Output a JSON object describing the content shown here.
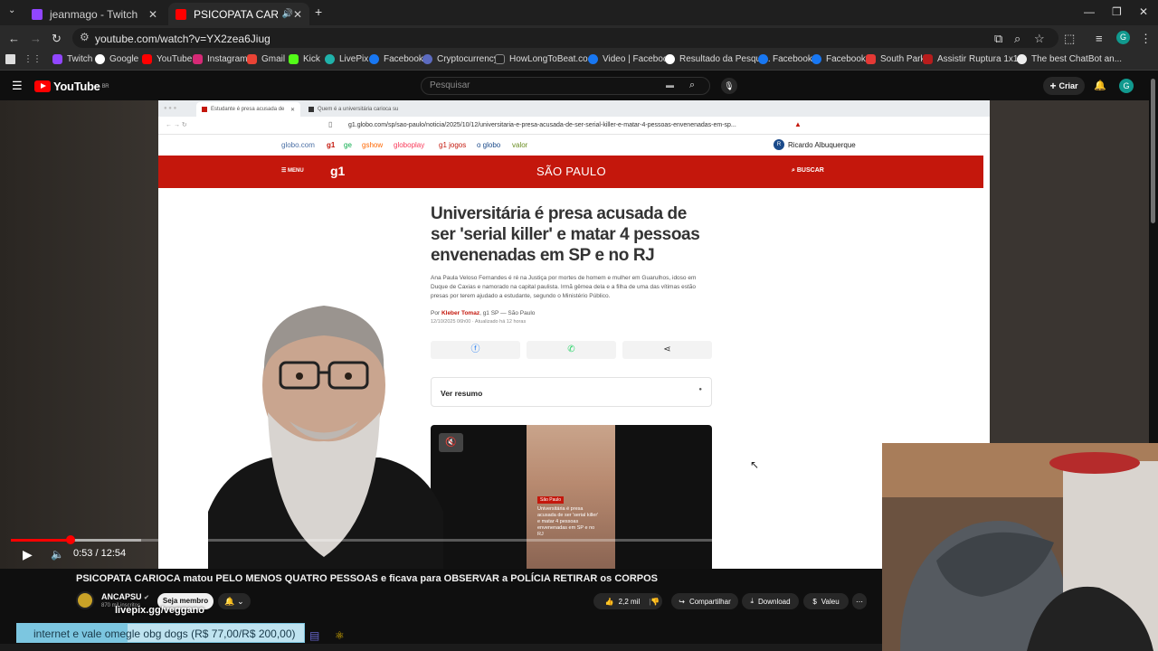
{
  "browser": {
    "tabs": [
      {
        "title": "jeanmago - Twitch",
        "color": "#9146ff"
      },
      {
        "title": "PSICOPATA CARIOCA matou",
        "color": "#ff0000"
      }
    ],
    "url": "youtube.com/watch?v=YX2zea6Jiug",
    "bookmarks": [
      "Twitch",
      "Google",
      "YouTube",
      "Instagram",
      "Gmail",
      "Kick",
      "LivePix",
      "Facebook",
      "Cryptocurrency",
      "HowLongToBeat.co...",
      "Video | Facebook",
      "Resultado da Pesqui...",
      "Facebook",
      "Facebook",
      "South Park",
      "Assistir Ruptura 1x1...",
      "The best ChatBot an..."
    ]
  },
  "youtube": {
    "logo": "YouTube",
    "logo_region": "BR",
    "search_placeholder": "Pesquisar",
    "create_label": "Criar",
    "avatar_letter": "G"
  },
  "inner_page": {
    "tabs": [
      "Estudante é presa acusada de",
      "Quem é a universitária carioca su"
    ],
    "url": "g1.globo.com/sp/sao-paulo/noticia/2025/10/12/universitaria-e-presa-acusada-de-ser-serial-killer-e-matar-4-pessoas-envenenadas-em-sp...",
    "globo_links": [
      "globo.com",
      "g1",
      "ge",
      "gshow",
      "globoplay",
      "g1 jogos",
      "o globo",
      "valor"
    ],
    "user": "Ricardo Albuquerque",
    "menu_label": "MENU",
    "site_logo": "g1",
    "section": "SÃO PAULO",
    "search_label": "BUSCAR",
    "headline": "Universitária é presa acusada de ser 'serial killer' e matar 4 pessoas envenenadas em SP e no RJ",
    "subheadline": "Ana Paula Veloso Fernandes é ré na Justiça por mortes de homem e mulher em Guarulhos, idoso em Duque de Caxias e namorado na capital paulista. Irmã gêmea dela e a filha de uma das vítimas estão presas por terem ajudado a estudante, segundo o Ministério Público.",
    "byline_prefix": "Por",
    "author": "Kleber Tomaz",
    "byline_suffix": ", g1 SP — São Paulo",
    "dateline": "12/10/2025 06h00 · Atualizado há 12 horas",
    "summary_label": "Ver resumo",
    "video_tag": "São Paulo",
    "video_caption": "Universitária é presa acusada de ser 'serial killer' e matar 4 pessoas envenenadas em SP e no RJ"
  },
  "player": {
    "current_time": "0:53",
    "duration": "12:54",
    "progress": 0.0685,
    "buffered": 0.15
  },
  "video_info": {
    "title": "PSICOPATA CARIOCA matou PELO MENOS QUATRO PESSOAS e ficava para OBSERVAR a POLÍCIA RETIRAR os CORPOS",
    "channel": "ANCAPSU",
    "subscribers": "870 mil inscritos",
    "member_label": "Seja membro",
    "likes": "2,2 mil",
    "share_label": "Compartilhar",
    "download_label": "Download",
    "thanks_label": "Valeu"
  },
  "overlay": {
    "livepix": "livepix.gg/veggano",
    "donation": "internet e vale omegle obg dogs (R$ 77,00/R$ 200,00)",
    "donation_progress": 0.385
  }
}
